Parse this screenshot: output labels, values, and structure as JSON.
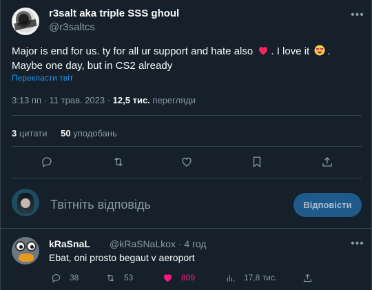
{
  "colors": {
    "background": "#15202b",
    "accent": "#1d9bf0",
    "like": "#f91880",
    "muted": "#8b98a5"
  },
  "tweet": {
    "author_name": "r3salt aka triple SSS ghoul",
    "author_handle": "@r3saltcs",
    "more_icon": "more-icon",
    "text_part1": "Major is end for us. ty for all ur support and hate also ",
    "emoji_heart": "red-heart-emoji",
    "text_part2": ". I love it ",
    "emoji_hearteyes": "heart-eyes-emoji",
    "text_part3": ". Maybe one day, but in CS2 already",
    "translate_label": "Перекласти твіт",
    "time_date": "3:13 пп · 11 трав. 2023 · ",
    "views_count": "12,5 тис.",
    "views_label": " перегляди",
    "quotes_count": "3",
    "quotes_label": " цитати",
    "likes_count": "50",
    "likes_label": " уподобань"
  },
  "actions": [
    "reply-icon",
    "retweet-icon",
    "like-icon",
    "bookmark-icon",
    "share-icon"
  ],
  "reply_box": {
    "placeholder": "Твітніть відповідь",
    "button_label": "Відповісти"
  },
  "comment": {
    "name": "kRaSnaL",
    "handle_time": "@kRaSNaLkox · 4 год",
    "text": "Ebat, oni prosto begaut v aeroport",
    "replies": "38",
    "retweets": "53",
    "likes": "809",
    "views": "17,8 тис."
  }
}
